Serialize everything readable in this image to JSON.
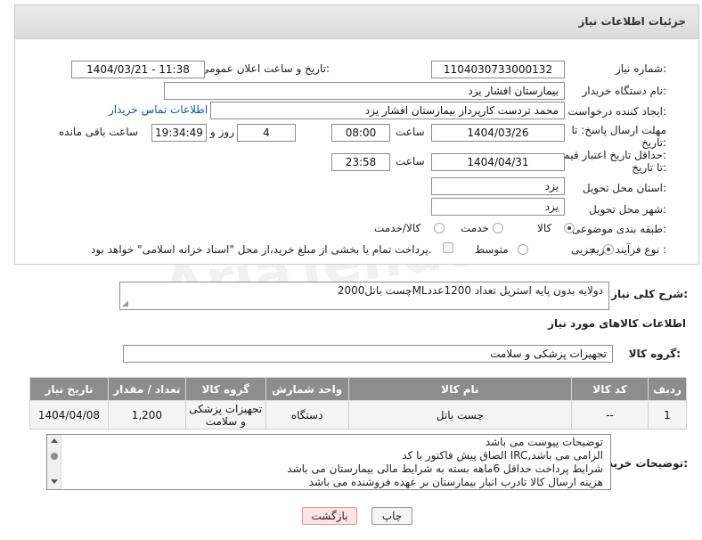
{
  "header": {
    "title": "جزئیات اطلاعات نیاز"
  },
  "form": {
    "need_number_label": "شماره نیاز:",
    "need_number": "1104030733000132",
    "announce_label": "تاریخ و ساعت اعلان عمومی:",
    "announce_value": "1404/03/21 - 11:38",
    "buyer_org_label": "نام دستگاه خریدار:",
    "buyer_org": "بیمارستان افشار یزد",
    "creator_label": "ایجاد کننده درخواست:",
    "creator": "محمد تردست کارپرداز بیمارستان افشار یزد",
    "contact_link": "اطلاعات تماس خریدار",
    "deadline_label_1": "مهلت ارسال پاسخ: تا",
    "deadline_label_2": "تاریخ:",
    "deadline_date": "1404/03/26",
    "time_label": "ساعت",
    "deadline_time": "08:00",
    "days_value": "4",
    "days_label": "روز و",
    "remaining_time": "19:34:49",
    "remaining_label": "ساعت باقی مانده",
    "price_validity_label_1": "حداقل تاریخ اعتبار قیمت:",
    "price_validity_label_2": "تا تاریخ:",
    "price_validity_date": "1404/04/31",
    "price_validity_time": "23:58",
    "province_label": "استان محل تحویل:",
    "province": "یزد",
    "city_label": "شهر محل تحویل:",
    "city": "یزد",
    "category_label": "طبقه بندی موضوعی:",
    "category_options": [
      "کالا",
      "خدمت",
      "کالا/خدمت"
    ],
    "process_label": "نوع فرآیند خرید :",
    "process_options": [
      "جزیی",
      "متوسط"
    ],
    "payment_note": "پرداخت تمام یا بخشی از مبلغ خرید،از محل \"اسناد خزانه اسلامی\" خواهد بود."
  },
  "description": {
    "label": "شرح کلی نیاز:",
    "text": "چست باتل2000MLدولایه بدون پایه استریل تعداد 1200عدد"
  },
  "goods": {
    "section_title": "اطلاعات کالاهای مورد نیاز",
    "group_label": "گروه کالا:",
    "group_value": "تجهیزات پزشکی و سلامت",
    "columns": [
      "ردیف",
      "کد کالا",
      "نام کالا",
      "واحد شمارش",
      "گروه کالا",
      "تعداد / مقدار",
      "تاریخ نیاز"
    ],
    "rows": [
      {
        "row": "1",
        "code": "--",
        "name": "چست باتل",
        "unit": "دستگاه",
        "group": "تجهیزات پزشکی و سلامت",
        "qty": "1,200",
        "date": "1404/04/08"
      }
    ]
  },
  "buyer_notes": {
    "label": "توضیحات خریدار:",
    "lines": [
      "توضیحات پیوست می باشد",
      "الصاق پیش فاکتور با کد  IRC,الزامی می باشد",
      "شرایط پرداخت   حداقل 6ماهه بسته به شرایط مالی بیمارستان می باشد",
      "هزینه ارسال کالا تادرب انبار بیمارستان بر عهده فروشنده می باشد"
    ]
  },
  "actions": {
    "print": "چاپ",
    "back": "بازگشت"
  },
  "colors": {
    "header_bg": "#e2e2e2",
    "table_header_bg": "#8d8d8d",
    "link": "#1a4fa0",
    "back_button_bg": "#fde3e3"
  }
}
